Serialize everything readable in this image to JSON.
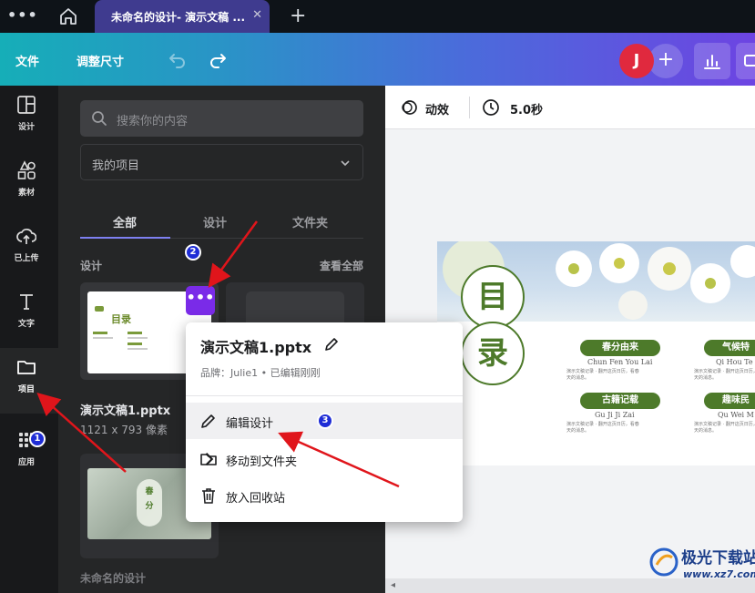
{
  "tabbar": {
    "tab_title": "未命名的设计- 演示文稿 ...",
    "close_glyph": "✕",
    "new_tab_glyph": "+"
  },
  "toolbar": {
    "file_label": "文件",
    "resize_label": "调整尺寸",
    "avatar_initial": "J",
    "avatar_add_glyph": "+"
  },
  "rail": {
    "items": [
      {
        "label": "设计",
        "icon": "layout-icon"
      },
      {
        "label": "素材",
        "icon": "elements-icon"
      },
      {
        "label": "已上传",
        "icon": "cloud-upload-icon"
      },
      {
        "label": "文字",
        "icon": "text-icon"
      },
      {
        "label": "项目",
        "icon": "folder-icon"
      },
      {
        "label": "应用",
        "icon": "apps-grid-icon"
      }
    ]
  },
  "panel": {
    "search_placeholder": "搜索你的内容",
    "filter_value": "我的项目",
    "tabs": [
      "全部",
      "设计",
      "文件夹"
    ],
    "section_title": "设计",
    "see_all": "查看全部",
    "more_glyph": "•••",
    "design_name": "演示文稿1.pptx",
    "design_size": "1121 x 793 像素",
    "thumb1_text": "目录",
    "thumb3_text": "春分",
    "section_title2": "未命名的设计"
  },
  "canvas": {
    "animate_label": "动效",
    "timer_label": "5.0秒",
    "title_chars": [
      "目",
      "录"
    ],
    "entries": [
      {
        "title": "春分由来",
        "pinyin": "Chun Fen You Lai"
      },
      {
        "title": "气候特",
        "pinyin": "Qi Hou Te"
      },
      {
        "title": "古籍记载",
        "pinyin": "Gu Ji Ji Zai"
      },
      {
        "title": "趣味民",
        "pinyin": "Qu Wei M"
      }
    ],
    "body_snippet": "演示文稿记录 · 翻开这页日历，看春天的消息。"
  },
  "context_menu": {
    "title": "演示文稿1.pptx",
    "meta": "品牌：Julie1 • 已编辑刚刚",
    "items": [
      {
        "label": "编辑设计",
        "icon": "pencil-icon"
      },
      {
        "label": "移动到文件夹",
        "icon": "folder-icon"
      },
      {
        "label": "放入回收站",
        "icon": "trash-icon"
      }
    ]
  },
  "annotations": {
    "badges": [
      "1",
      "2",
      "3"
    ],
    "color": "#e0151b"
  },
  "watermark": {
    "name": "极光下载站",
    "url": "www.xz7.com"
  },
  "colors": {
    "accent_purple": "#7a2be8",
    "avatar_red": "#e0293e",
    "slide_green": "#4d7a2a"
  }
}
